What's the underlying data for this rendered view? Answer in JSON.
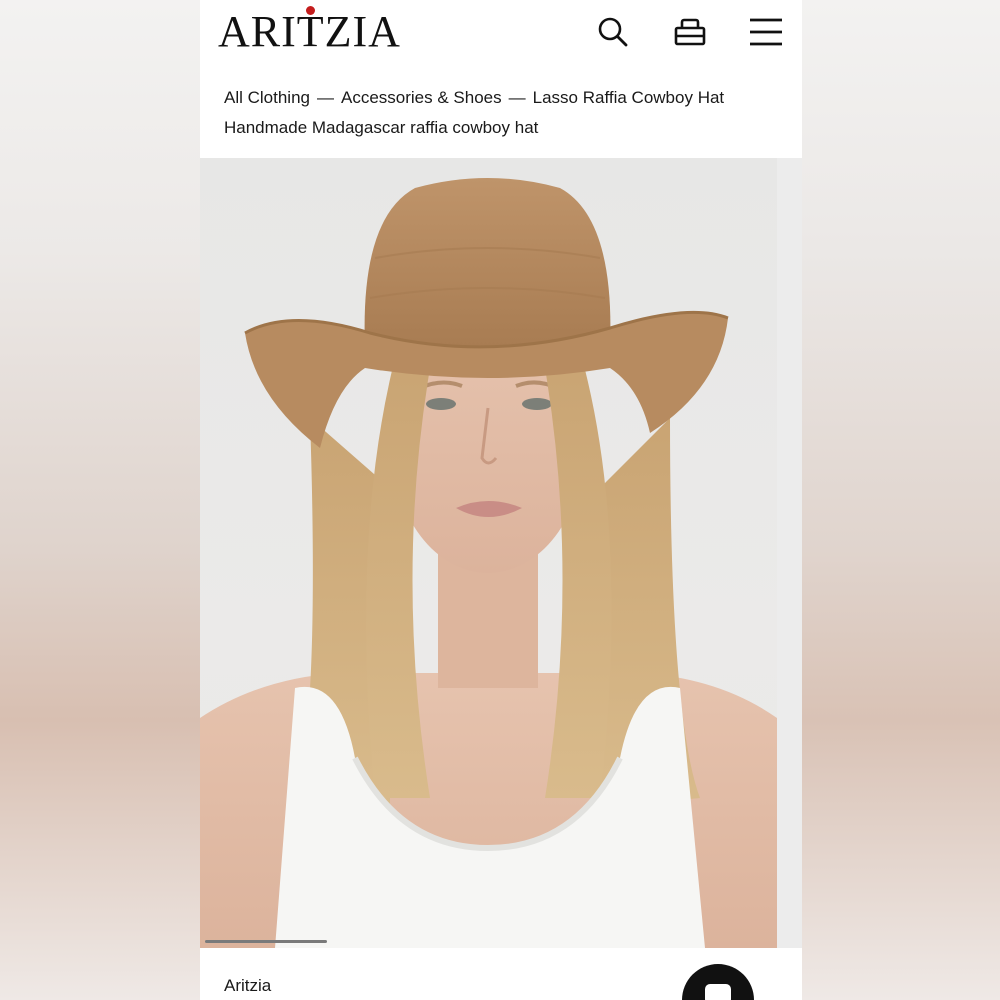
{
  "brand": {
    "logo_text": "ARITZIA"
  },
  "header": {
    "search_icon": "search-icon",
    "bag_icon": "shopping-bag-icon",
    "menu_icon": "hamburger-menu-icon"
  },
  "breadcrumb": {
    "items": [
      "All Clothing",
      "Accessories & Shoes",
      "Lasso Raffia Cowboy Hat"
    ],
    "separator": "—"
  },
  "product": {
    "subtitle": "Handmade Madagascar raffia cowboy hat",
    "brand_label": "Aritzia",
    "image_alt": "Model wearing a tan raffia cowboy hat and white tank top"
  },
  "colors": {
    "logo_accent": "#c41d1d",
    "hat": "#b68a5f",
    "text": "#1a1a1a"
  }
}
